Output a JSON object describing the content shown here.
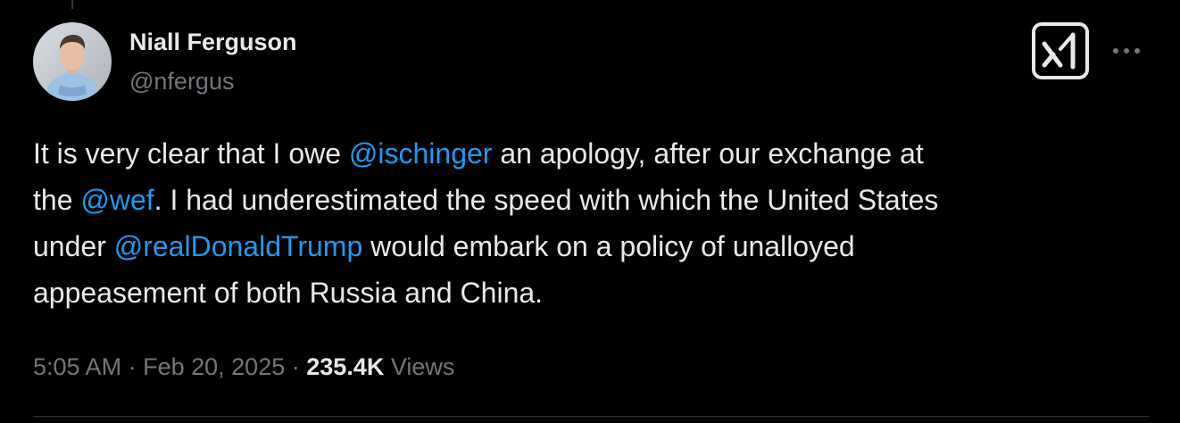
{
  "author": {
    "display_name": "Niall Ferguson",
    "handle": "@nfergus",
    "avatar_icon": "profile-photo"
  },
  "actions": {
    "grok_icon": "grok-icon",
    "more_icon": "more-dots-icon"
  },
  "tweet": {
    "line1": {
      "before": "It is very clear that I owe ",
      "mention": "@ischinger",
      "after": " an apology, after our exchange at"
    },
    "line2": {
      "before": "the ",
      "mention": "@wef",
      "after": ". I had underestimated the speed with which the United States"
    },
    "line3": {
      "before": "under ",
      "mention": "@realDonaldTrump",
      "after": " would embark on a policy of unalloyed"
    },
    "line4": {
      "text": "appeasement of both Russia and China."
    }
  },
  "meta": {
    "time": "5:05 AM",
    "separator": "·",
    "date": "Feb 20, 2025",
    "views_count": "235.4K",
    "views_label": "Views"
  },
  "colors": {
    "background": "#000000",
    "text": "#e7e9ea",
    "secondary": "#71767b",
    "link": "#1d9bf0"
  }
}
